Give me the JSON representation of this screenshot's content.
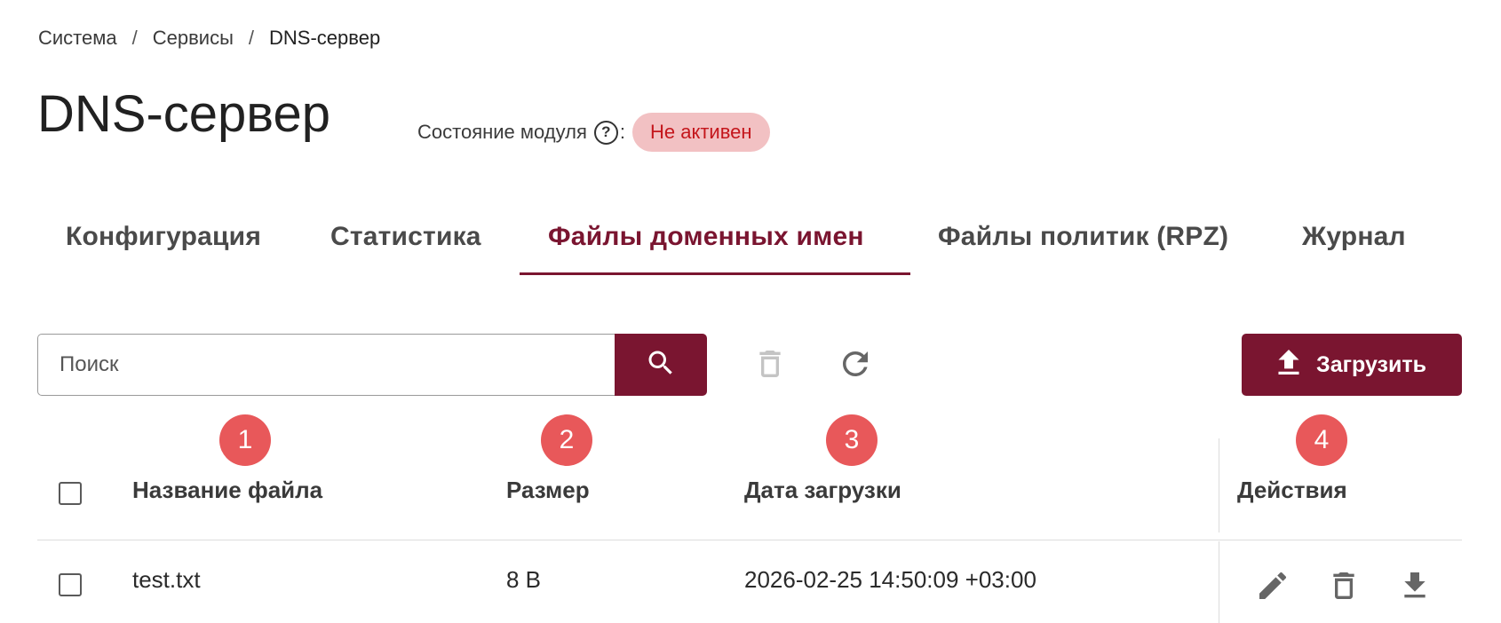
{
  "breadcrumb": {
    "items": [
      "Система",
      "Сервисы",
      "DNS-сервер"
    ],
    "separator": "/"
  },
  "page": {
    "title": "DNS-сервер",
    "status_label": "Состояние модуля",
    "help_symbol": "?",
    "status_colon": ":",
    "status_value": "Не активен"
  },
  "tabs": [
    {
      "label": "Конфигурация",
      "active": false
    },
    {
      "label": "Статистика",
      "active": false
    },
    {
      "label": "Файлы доменных имен",
      "active": true
    },
    {
      "label": "Файлы политик (RPZ)",
      "active": false
    },
    {
      "label": "Журнал",
      "active": false
    }
  ],
  "toolbar": {
    "search_placeholder": "Поиск",
    "search_value": "",
    "upload_label": "Загрузить",
    "icons": [
      "search-icon",
      "delete-icon",
      "refresh-icon",
      "upload-icon"
    ]
  },
  "markers": [
    "1",
    "2",
    "3",
    "4"
  ],
  "table": {
    "columns": [
      "Название файла",
      "Размер",
      "Дата загрузки",
      "Действия"
    ],
    "rows": [
      {
        "name": "test.txt",
        "size": "8 B",
        "date": "2026-02-25 14:50:09 +03:00",
        "actions": [
          "edit-icon",
          "delete-icon",
          "download-icon"
        ]
      }
    ]
  },
  "colors": {
    "accent": "#7a1530",
    "status_bg": "#f2c1c3",
    "status_text": "#c4161c",
    "marker": "#e8585a"
  }
}
